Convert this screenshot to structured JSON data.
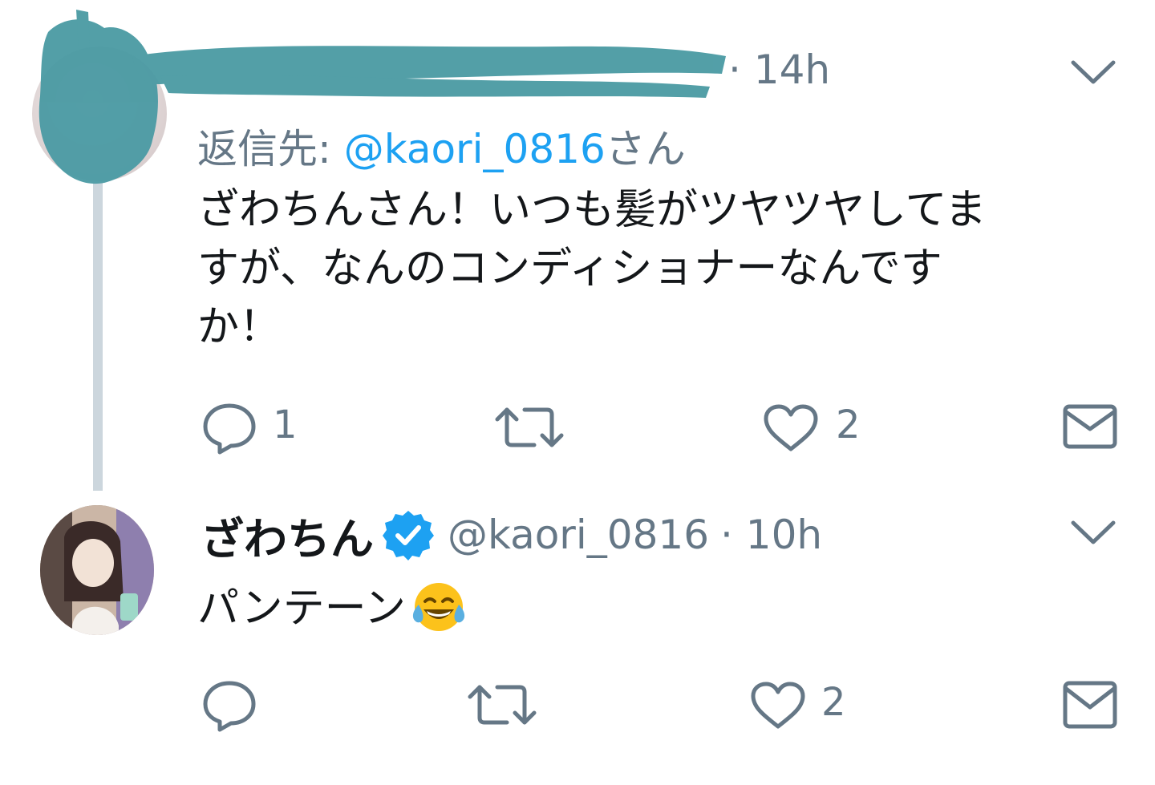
{
  "tweet1": {
    "time": "· 14h",
    "reply_to_prefix": "返信先: ",
    "reply_to_handle": "@kaori_0816",
    "reply_to_suffix": "さん",
    "body_lines": [
      "ざわちんさん！いつも髪がツヤツヤしてま",
      "すが、なんのコンディショナーなんです",
      "か！"
    ],
    "actions": {
      "reply_count": "1",
      "retweet_count": "",
      "like_count": "2"
    }
  },
  "tweet2": {
    "name": "ざわちん",
    "handle": "@kaori_0816",
    "time": "· 10h",
    "body": "パンテーン",
    "emoji": "😂",
    "actions": {
      "reply_count": "",
      "retweet_count": "",
      "like_count": "2"
    }
  },
  "colors": {
    "text_primary": "#14171a",
    "text_secondary": "#657786",
    "link": "#1da1f2",
    "verified": "#1da1f2",
    "thread_line": "#ccd6dd",
    "redaction": "#4a9aa3"
  },
  "icons": [
    "chevron-down-icon",
    "reply-icon",
    "retweet-icon",
    "like-icon",
    "share-icon",
    "verified-icon"
  ]
}
